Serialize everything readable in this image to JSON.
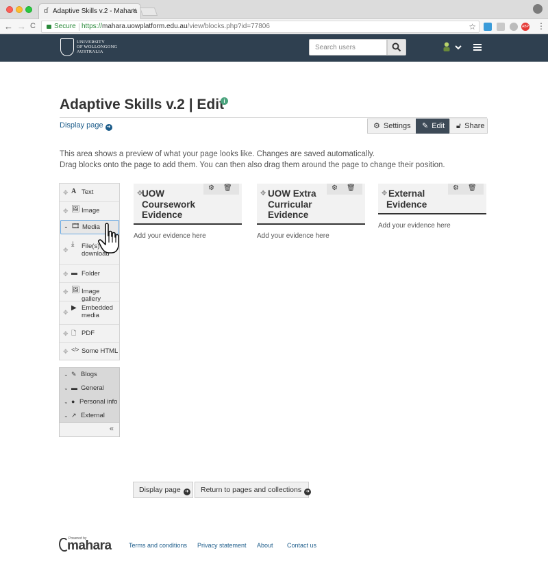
{
  "browser": {
    "tab_title": "Adaptive Skills v.2 - Mahara",
    "tab_close": "×",
    "secure_label": "Secure",
    "url_scheme": "https://",
    "url_host": "mahara.uowplatform.edu.au",
    "url_path": "/view/blocks.php?id=77806",
    "back": "←",
    "forward": "→",
    "reload": "C",
    "star": "☆",
    "menu": "⋮",
    "abp": "ABP"
  },
  "header": {
    "logo_text": [
      "UNIVERSITY",
      "OF WOLLONGONG",
      "AUSTRALIA"
    ],
    "search_placeholder": "Search users",
    "chevron": "⌄"
  },
  "page": {
    "title": "Adaptive Skills v.2 | Edit",
    "info": "i",
    "display_link": "Display page",
    "buttons": {
      "settings": "Settings",
      "edit": "Edit",
      "share": "Share"
    },
    "intro_lines": [
      "This area shows a preview of what your page looks like. Changes are saved automatically.",
      "Drag blocks onto the page to add them. You can then also drag them around the page to change their position."
    ]
  },
  "palette": {
    "items": [
      {
        "label": "Text",
        "icon": "text-icon"
      },
      {
        "label": "Image",
        "icon": "image-icon"
      },
      {
        "label": "Media",
        "icon": "film-icon"
      },
      {
        "label": "File(s) to download",
        "icon": "download-icon"
      },
      {
        "label": "Folder",
        "icon": "folder-icon"
      },
      {
        "label": "Image gallery",
        "icon": "image-icon"
      },
      {
        "label": "Embedded media",
        "icon": "video-icon"
      },
      {
        "label": "PDF",
        "icon": "pdf-icon"
      },
      {
        "label": "Some HTML",
        "icon": "code-icon"
      }
    ],
    "categories": [
      {
        "label": "Blogs",
        "icon": "pencil-icon"
      },
      {
        "label": "General",
        "icon": "briefcase-icon"
      },
      {
        "label": "Personal info",
        "icon": "user-icon"
      },
      {
        "label": "External",
        "icon": "external-link-icon"
      }
    ],
    "collapse": "«"
  },
  "blocks": [
    {
      "title_lines": [
        "UOW",
        "Coursework",
        "Evidence"
      ],
      "placeholder": "Add your evidence here"
    },
    {
      "title_lines": [
        "UOW Extra",
        "Curricular",
        "Evidence"
      ],
      "placeholder": "Add your evidence here"
    },
    {
      "title_lines": [
        "External",
        "Evidence"
      ],
      "placeholder": "Add your evidence here"
    }
  ],
  "bottom": {
    "display_page": "Display page",
    "return": "Return to pages and collections"
  },
  "footer": {
    "powered_by": "Powered by",
    "brand": "mahara",
    "links": [
      "Terms and conditions",
      "Privacy statement",
      "About",
      "Contact us"
    ]
  },
  "colors": {
    "header_bg": "#2f4050",
    "link": "#1c5c8a",
    "edit_active": "#3d4a57",
    "info_green": "#4aa37d",
    "drag_highlight": "#6aa9e2"
  }
}
